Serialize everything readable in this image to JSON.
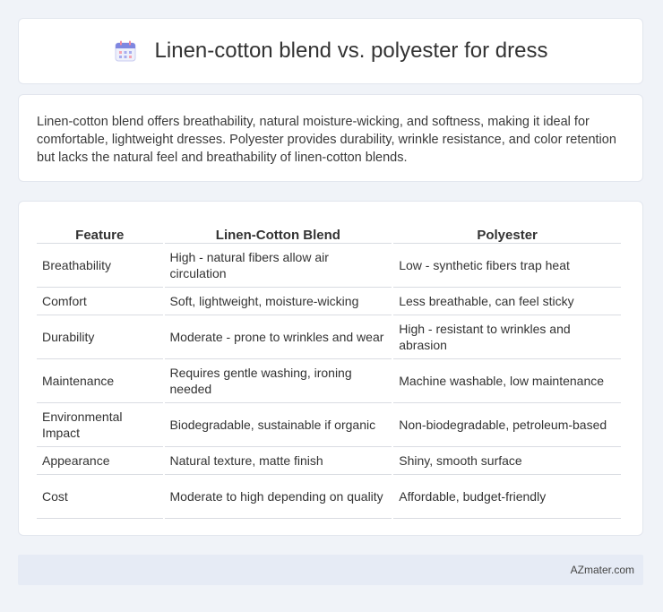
{
  "header": {
    "icon": "calendar-icon",
    "title": "Linen-cotton blend vs. polyester for dress"
  },
  "description": "Linen-cotton blend offers breathability, natural moisture-wicking, and softness, making it ideal for comfortable, lightweight dresses. Polyester provides durability, wrinkle resistance, and color retention but lacks the natural feel and breathability of linen-cotton blends.",
  "table": {
    "headers": [
      "Feature",
      "Linen-Cotton Blend",
      "Polyester"
    ],
    "rows": [
      [
        "Breathability",
        "High - natural fibers allow air circulation",
        "Low - synthetic fibers trap heat"
      ],
      [
        "Comfort",
        "Soft, lightweight, moisture-wicking",
        "Less breathable, can feel sticky"
      ],
      [
        "Durability",
        "Moderate - prone to wrinkles and wear",
        "High - resistant to wrinkles and abrasion"
      ],
      [
        "Maintenance",
        "Requires gentle washing, ironing needed",
        "Machine washable, low maintenance"
      ],
      [
        "Environmental Impact",
        "Biodegradable, sustainable if organic",
        "Non-biodegradable, petroleum-based"
      ],
      [
        "Appearance",
        "Natural texture, matte finish",
        "Shiny, smooth surface"
      ],
      [
        "Cost",
        "Moderate to high depending on quality",
        "Affordable, budget-friendly"
      ]
    ]
  },
  "footer": {
    "brand": "AZmater.com"
  }
}
